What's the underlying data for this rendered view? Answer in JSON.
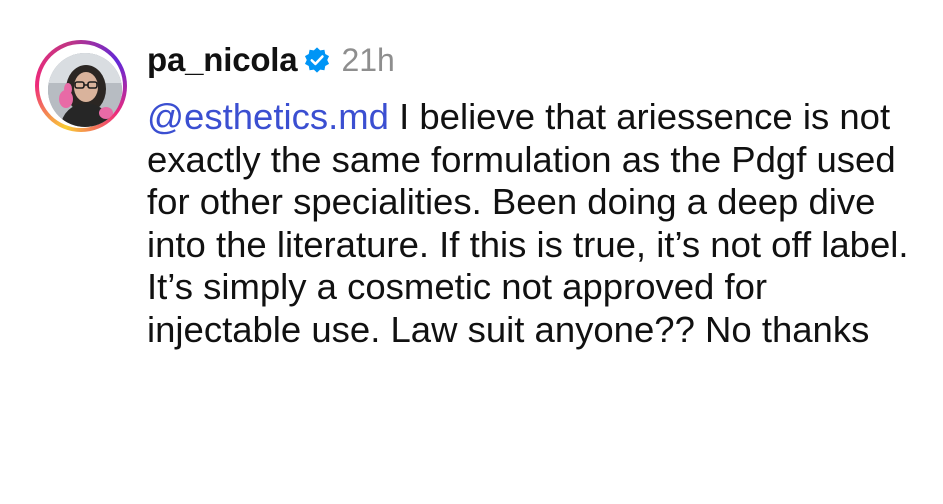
{
  "comment": {
    "username": "pa_nicola",
    "timestamp": "21h",
    "verified": true,
    "mention": "@esthetics.md",
    "text": " I believe that ariessence is not exactly the same formulation as the Pdgf used for other specialities. Been doing a deep dive into the literature. If this is true, it’s not off label. It’s simply a cosmetic not approved for injectable use. Law suit anyone?? No thanks"
  },
  "colors": {
    "mention": "#3b4fd1",
    "verified_badge": "#0095f6",
    "timestamp": "#8e8e8e",
    "text": "#111111"
  },
  "icons": {
    "verified": "verified-badge-icon",
    "avatar": "profile-photo"
  }
}
